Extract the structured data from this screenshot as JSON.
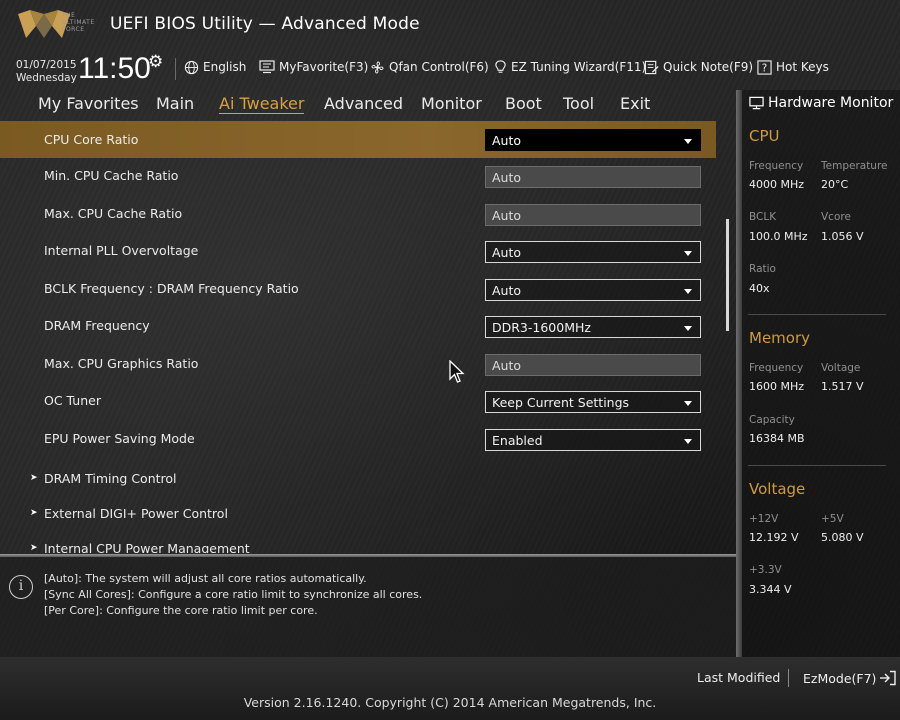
{
  "app": {
    "title": "UEFI BIOS Utility — Advanced Mode",
    "logo_text": "THE ULTIMATE FORCE"
  },
  "info_bar": {
    "date": "01/07/2015",
    "weekday": "Wednesday",
    "time": "11:50",
    "tools": [
      {
        "label": "English",
        "icon": "globe-icon"
      },
      {
        "label": "MyFavorite(F3)",
        "icon": "favorite-monitor-icon"
      },
      {
        "label": "Qfan Control(F6)",
        "icon": "fan-icon"
      },
      {
        "label": "EZ Tuning Wizard(F11)",
        "icon": "lightbulb-icon"
      },
      {
        "label": "Quick Note(F9)",
        "icon": "note-icon"
      },
      {
        "label": "Hot Keys",
        "icon": "question-box-icon"
      }
    ]
  },
  "menu": {
    "items": [
      "My Favorites",
      "Main",
      "Ai Tweaker",
      "Advanced",
      "Monitor",
      "Boot",
      "Tool",
      "Exit"
    ],
    "active": "Ai Tweaker",
    "accent_color": "#d8a041"
  },
  "settings": [
    {
      "label": "CPU Core Ratio",
      "value": "Auto",
      "kind": "dropdown",
      "selected": true
    },
    {
      "label": "Min. CPU Cache Ratio",
      "value": "Auto",
      "kind": "readonly"
    },
    {
      "label": "Max. CPU Cache Ratio",
      "value": "Auto",
      "kind": "readonly"
    },
    {
      "label": "Internal PLL Overvoltage",
      "value": "Auto",
      "kind": "dropdown"
    },
    {
      "label": "BCLK Frequency : DRAM Frequency Ratio",
      "value": "Auto",
      "kind": "dropdown"
    },
    {
      "label": "DRAM Frequency",
      "value": "DDR3-1600MHz",
      "kind": "dropdown"
    },
    {
      "label": "Max. CPU Graphics Ratio",
      "value": "Auto",
      "kind": "readonly"
    },
    {
      "label": "OC Tuner",
      "value": "Keep Current Settings",
      "kind": "dropdown"
    },
    {
      "label": "EPU Power Saving Mode",
      "value": "Enabled",
      "kind": "dropdown"
    }
  ],
  "submenus": [
    "DRAM Timing Control",
    "External DIGI+ Power Control",
    "Internal CPU Power Management"
  ],
  "help": [
    "[Auto]: The system will adjust all core ratios automatically.",
    "[Sync All Cores]: Configure a core ratio limit to synchronize all cores.",
    "[Per Core]: Configure the core ratio limit per core."
  ],
  "hardware_monitor": {
    "title": "Hardware Monitor",
    "section_color": "#d29a3f",
    "cpu": {
      "heading": "CPU",
      "frequency_label": "Frequency",
      "frequency": "4000 MHz",
      "temperature_label": "Temperature",
      "temperature": "20°C",
      "bclk_label": "BCLK",
      "bclk": "100.0 MHz",
      "vcore_label": "Vcore",
      "vcore": "1.056 V",
      "ratio_label": "Ratio",
      "ratio": "40x"
    },
    "memory": {
      "heading": "Memory",
      "frequency_label": "Frequency",
      "frequency": "1600 MHz",
      "voltage_label": "Voltage",
      "voltage": "1.517 V",
      "capacity_label": "Capacity",
      "capacity": "16384 MB"
    },
    "voltage": {
      "heading": "Voltage",
      "v12_label": "+12V",
      "v12": "12.192 V",
      "v5_label": "+5V",
      "v5": "5.080 V",
      "v33_label": "+3.3V",
      "v33": "3.344 V"
    }
  },
  "footer": {
    "last_modified": "Last Modified",
    "ezmode": "EzMode(F7)",
    "version": "Version 2.16.1240. Copyright (C) 2014 American Megatrends, Inc."
  }
}
